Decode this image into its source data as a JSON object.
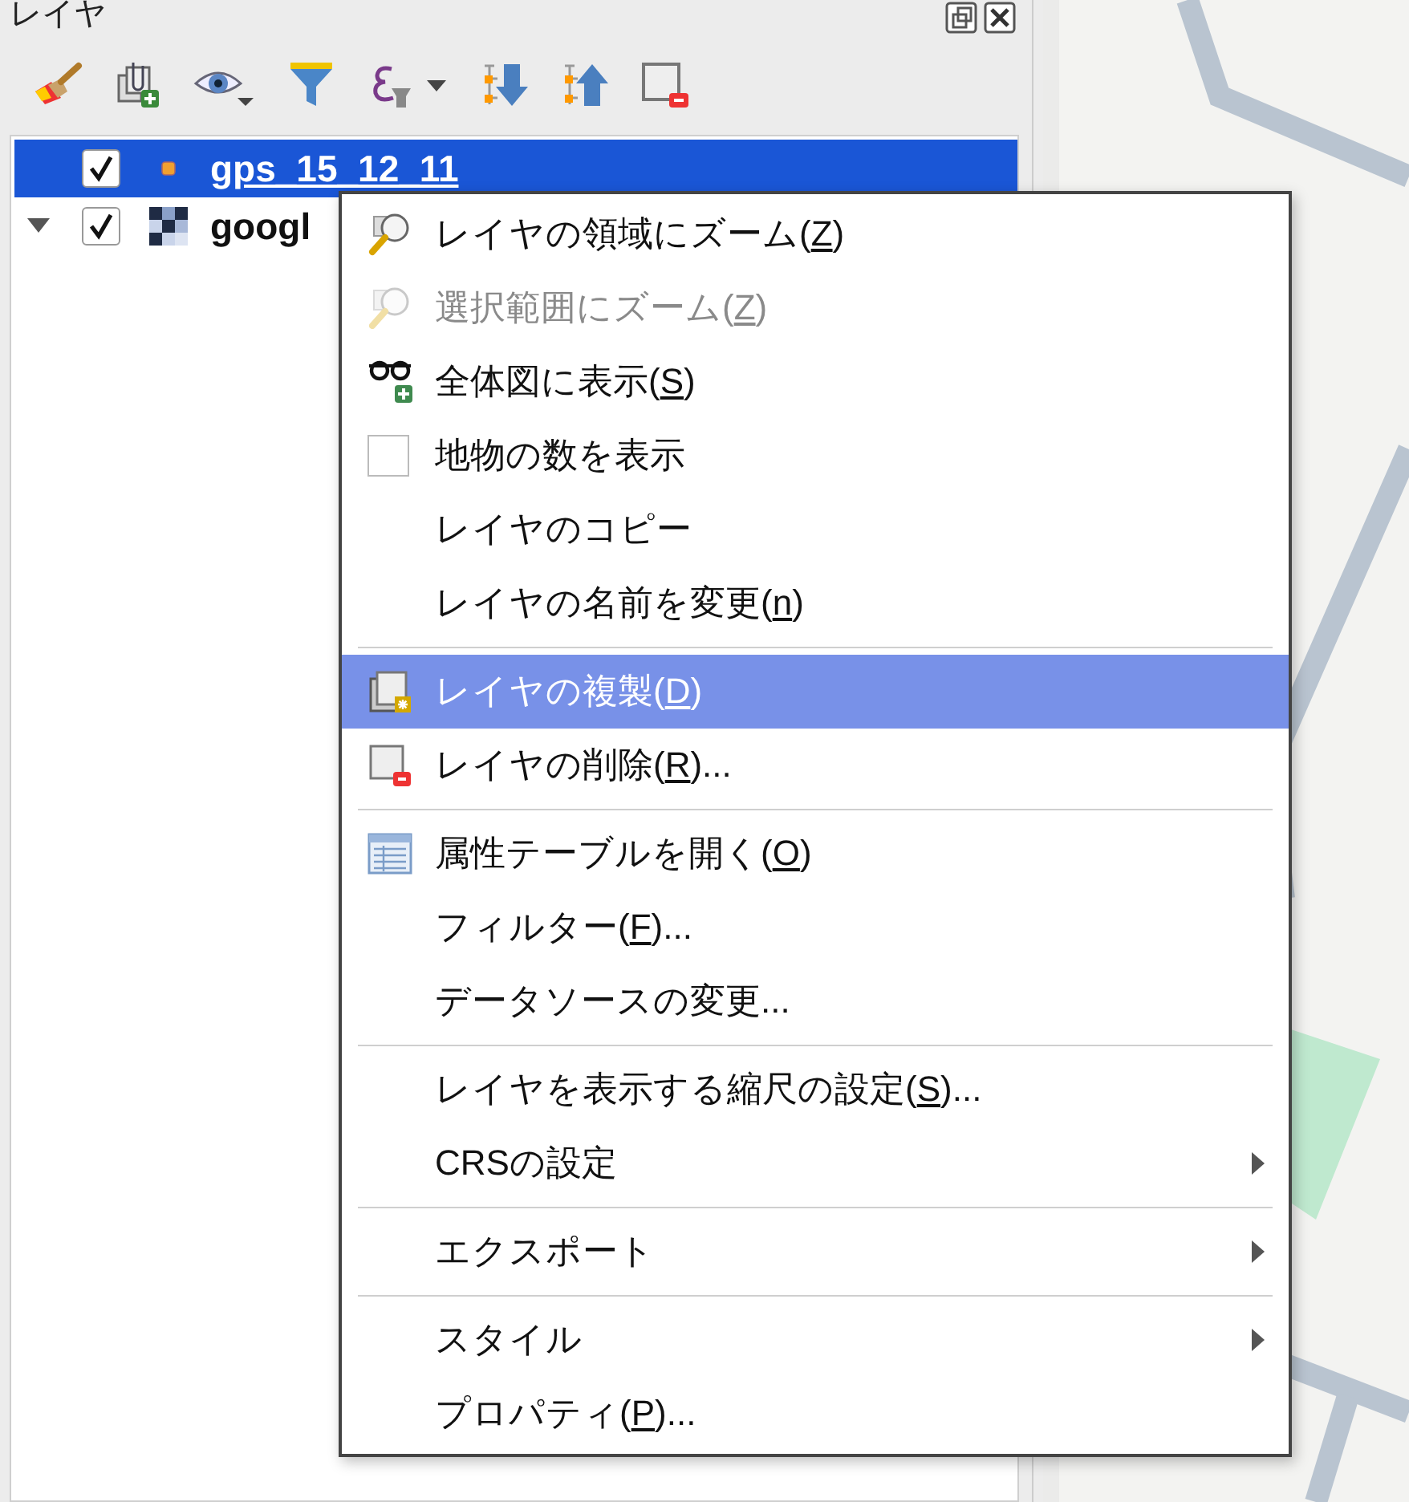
{
  "panel": {
    "title": "レイヤ"
  },
  "layers": [
    {
      "name": "gps_15_12_11",
      "kind": "vector",
      "selected": true,
      "checked": true,
      "expandable": false
    },
    {
      "name": "googl",
      "kind": "raster",
      "selected": false,
      "checked": true,
      "expandable": true,
      "expanded": true
    }
  ],
  "menu": {
    "sections": [
      [
        {
          "kind": "zoom",
          "before": "レイヤの領域にズーム(",
          "key": "Z",
          "after": ")",
          "disabled": false,
          "selected": false,
          "submenu": false
        },
        {
          "kind": "zoom",
          "before": "選択範囲にズーム(",
          "key": "Z",
          "after": ")",
          "disabled": true,
          "selected": false,
          "submenu": false
        },
        {
          "kind": "overview",
          "before": "全体図に表示(",
          "key": "S",
          "after": ")",
          "disabled": false,
          "selected": false,
          "submenu": false
        },
        {
          "kind": "checkbox",
          "checked": false,
          "before": "地物の数を表示",
          "disabled": false,
          "selected": false,
          "submenu": false
        },
        {
          "kind": "plain",
          "before": "レイヤのコピー",
          "disabled": false,
          "selected": false,
          "submenu": false
        },
        {
          "kind": "plain",
          "before": "レイヤの名前を変更(",
          "key": "n",
          "after": ")",
          "disabled": false,
          "selected": false,
          "submenu": false
        }
      ],
      [
        {
          "kind": "duplicate",
          "before": "レイヤの複製(",
          "key": "D",
          "after": ")",
          "disabled": false,
          "selected": true,
          "submenu": false
        },
        {
          "kind": "remove",
          "before": "レイヤの削除(",
          "key": "R",
          "after": ")...",
          "disabled": false,
          "selected": false,
          "submenu": false
        }
      ],
      [
        {
          "kind": "table",
          "before": "属性テーブルを開く(",
          "key": "O",
          "after": ")",
          "disabled": false,
          "selected": false,
          "submenu": false
        },
        {
          "kind": "plain",
          "before": "フィルター(",
          "key": "F",
          "after": ")...",
          "disabled": false,
          "selected": false,
          "submenu": false
        },
        {
          "kind": "plain",
          "before": "データソースの変更...",
          "disabled": false,
          "selected": false,
          "submenu": false
        }
      ],
      [
        {
          "kind": "plain",
          "before": "レイヤを表示する縮尺の設定(",
          "key": "S",
          "after": ")...",
          "disabled": false,
          "selected": false,
          "submenu": false
        },
        {
          "kind": "plain",
          "before": "CRSの設定",
          "disabled": false,
          "selected": false,
          "submenu": true
        }
      ],
      [
        {
          "kind": "plain",
          "before": "エクスポート",
          "disabled": false,
          "selected": false,
          "submenu": true
        }
      ],
      [
        {
          "kind": "plain",
          "before": "スタイル",
          "disabled": false,
          "selected": false,
          "submenu": true
        },
        {
          "kind": "plain",
          "before": "プロパティ(",
          "key": "P",
          "after": ")...",
          "disabled": false,
          "selected": false,
          "submenu": false
        }
      ]
    ]
  }
}
